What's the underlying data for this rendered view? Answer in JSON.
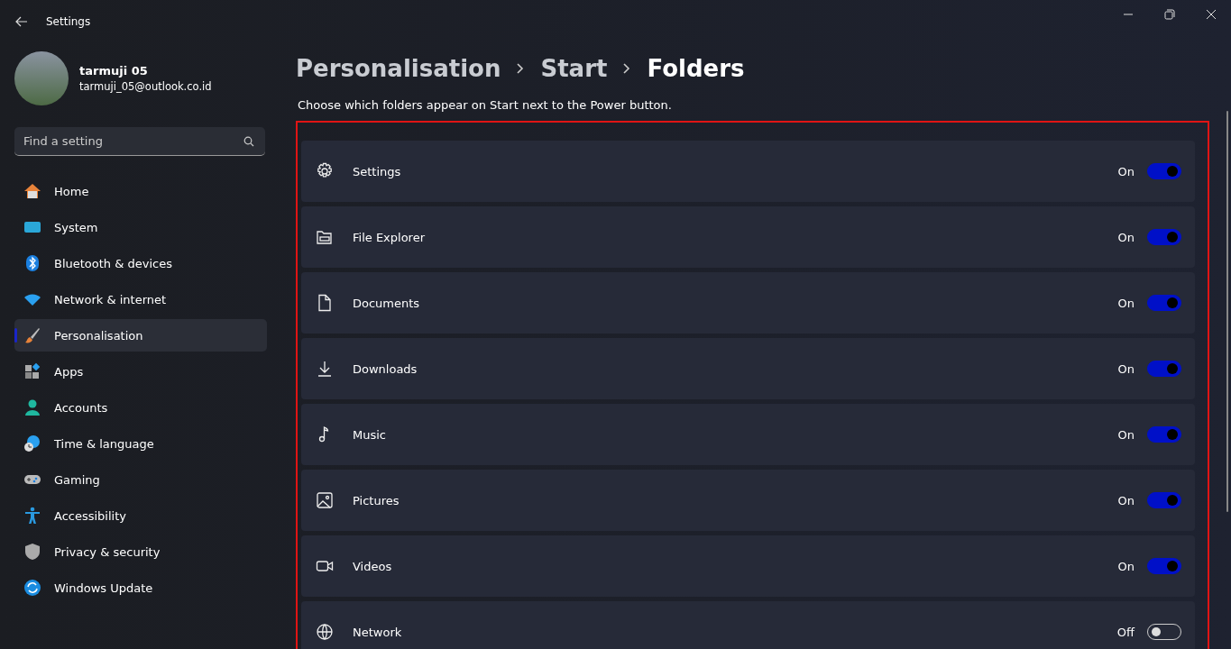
{
  "window": {
    "title": "Settings"
  },
  "user": {
    "name": "tarmuji 05",
    "email": "tarmuji_05@outlook.co.id"
  },
  "search": {
    "placeholder": "Find a setting"
  },
  "nav": [
    {
      "label": "Home",
      "kind": "home",
      "selected": false
    },
    {
      "label": "System",
      "kind": "system",
      "selected": false
    },
    {
      "label": "Bluetooth & devices",
      "kind": "bluetooth",
      "selected": false
    },
    {
      "label": "Network & internet",
      "kind": "wifi",
      "selected": false
    },
    {
      "label": "Personalisation",
      "kind": "brush",
      "selected": true
    },
    {
      "label": "Apps",
      "kind": "apps",
      "selected": false
    },
    {
      "label": "Accounts",
      "kind": "person",
      "selected": false
    },
    {
      "label": "Time & language",
      "kind": "clock",
      "selected": false
    },
    {
      "label": "Gaming",
      "kind": "gamepad",
      "selected": false
    },
    {
      "label": "Accessibility",
      "kind": "access",
      "selected": false
    },
    {
      "label": "Privacy & security",
      "kind": "shield",
      "selected": false
    },
    {
      "label": "Windows Update",
      "kind": "update",
      "selected": false
    }
  ],
  "breadcrumb": [
    "Personalisation",
    "Start",
    "Folders"
  ],
  "description": "Choose which folders appear on Start next to the Power button.",
  "folders": [
    {
      "label": "Settings",
      "kind": "gear",
      "state": "On",
      "on": true
    },
    {
      "label": "File Explorer",
      "kind": "folder",
      "state": "On",
      "on": true
    },
    {
      "label": "Documents",
      "kind": "document",
      "state": "On",
      "on": true
    },
    {
      "label": "Downloads",
      "kind": "download",
      "state": "On",
      "on": true
    },
    {
      "label": "Music",
      "kind": "music",
      "state": "On",
      "on": true
    },
    {
      "label": "Pictures",
      "kind": "picture",
      "state": "On",
      "on": true
    },
    {
      "label": "Videos",
      "kind": "video",
      "state": "On",
      "on": true
    },
    {
      "label": "Network",
      "kind": "globe",
      "state": "Off",
      "on": false
    }
  ]
}
